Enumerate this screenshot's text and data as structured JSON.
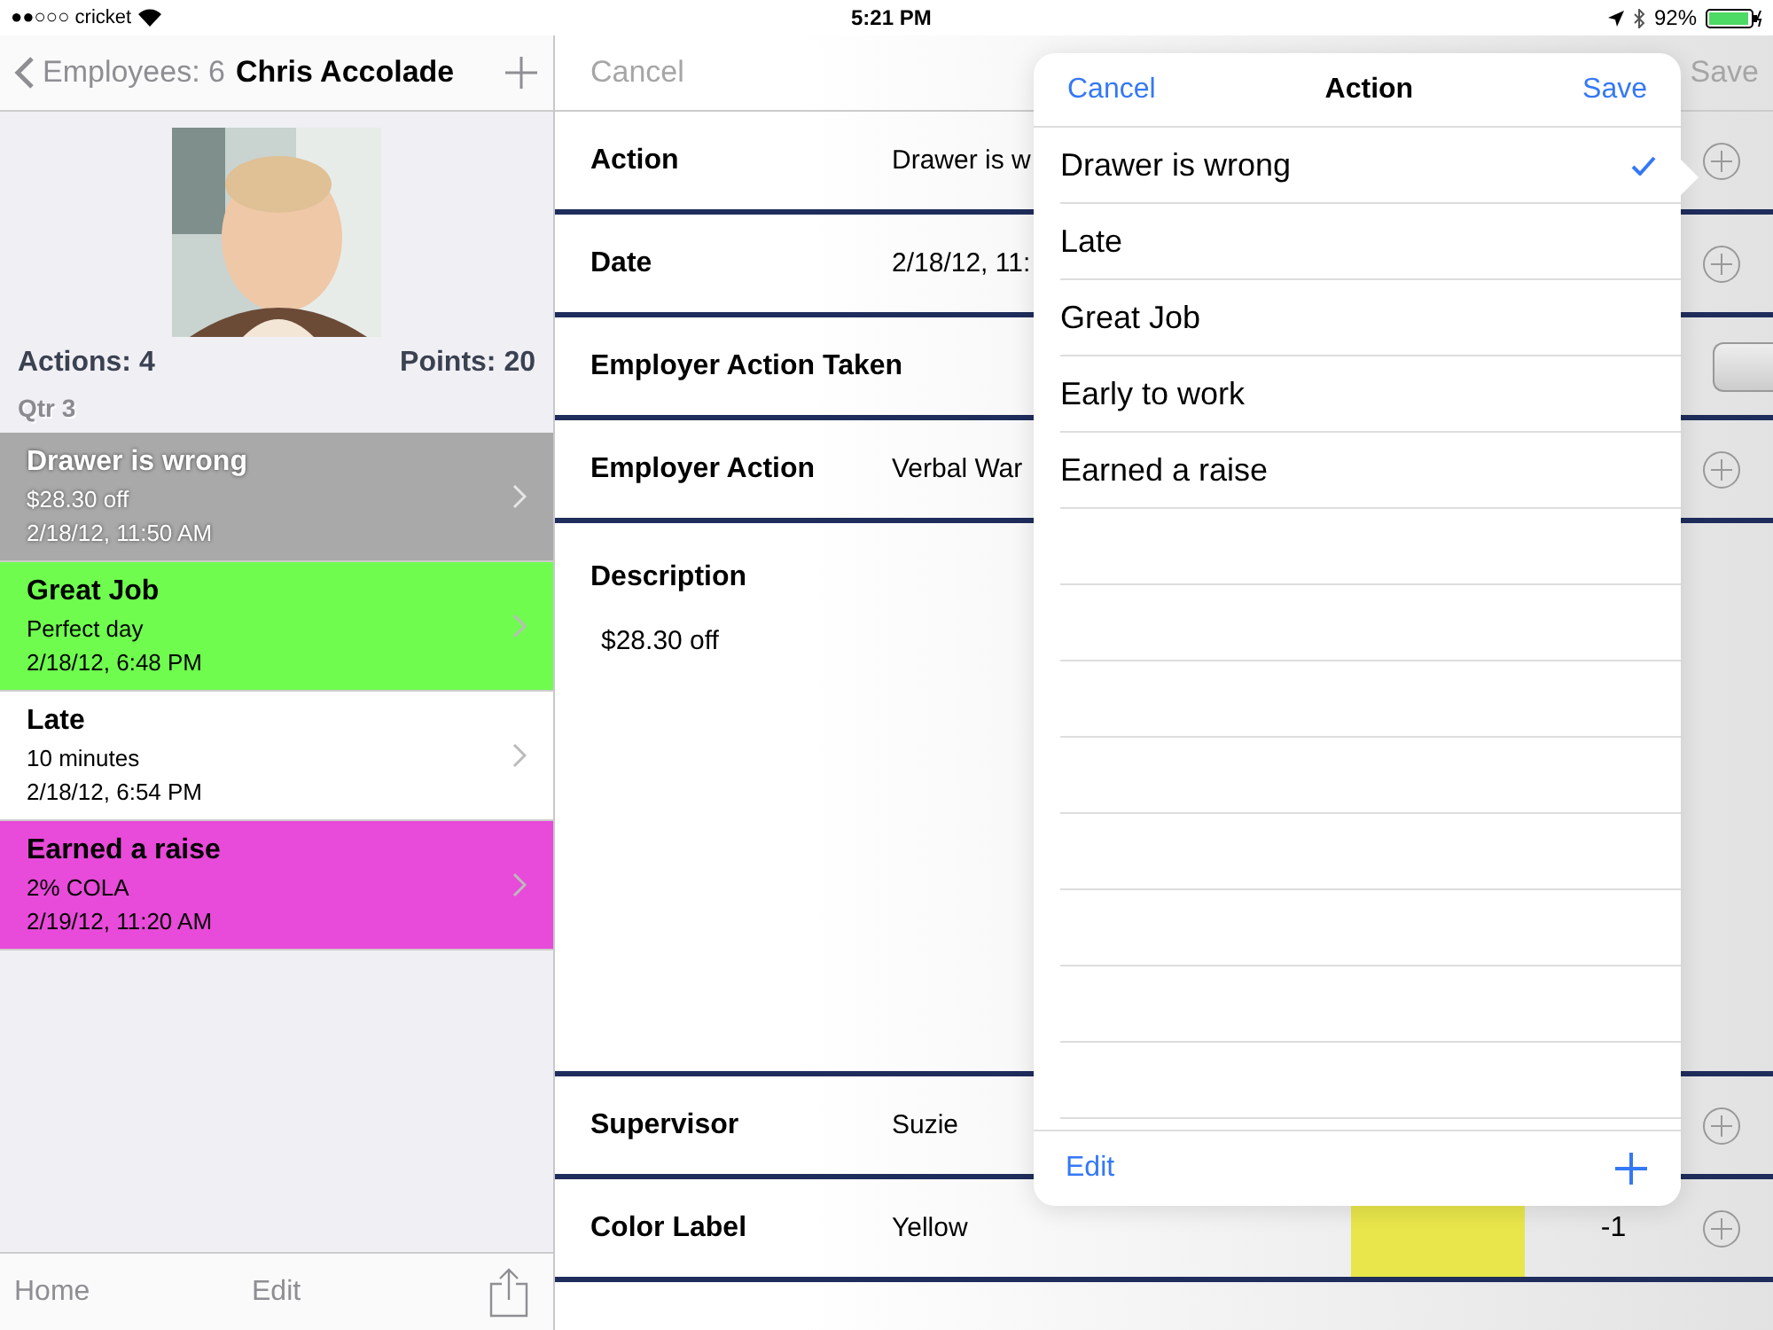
{
  "status_bar": {
    "carrier": "●●○○○ cricket",
    "time": "5:21 PM",
    "battery": "92%"
  },
  "sidebar": {
    "back": "Employees: 6",
    "title": "Chris Accolade",
    "actions": "Actions: 4",
    "points": "Points: 20",
    "section": "Qtr 3",
    "items": [
      {
        "title": "Drawer is wrong",
        "note": "$28.30 off",
        "date": "2/18/12, 11:50 AM",
        "color": "#a9a9a9",
        "selected": true
      },
      {
        "title": "Great Job",
        "note": "Perfect day",
        "date": "2/18/12, 6:48 PM",
        "color": "#6ffc4f",
        "selected": false
      },
      {
        "title": "Late",
        "note": "10 minutes",
        "date": "2/18/12, 6:54 PM",
        "color": "#ffffff",
        "selected": false
      },
      {
        "title": "Earned a raise",
        "note": "2% COLA",
        "date": "2/19/12, 11:20 AM",
        "color": "#e84ad9",
        "selected": false
      }
    ],
    "toolbar": [
      "Home",
      "Edit"
    ]
  },
  "form": {
    "cancel": "Cancel",
    "save": "Save",
    "rows": [
      {
        "kind": "field",
        "label": "Action",
        "value": "Drawer is w"
      },
      {
        "kind": "field",
        "label": "Date",
        "value": "2/18/12, 11:"
      },
      {
        "kind": "toggle",
        "label": "Employer Action Taken",
        "on": false
      },
      {
        "kind": "field",
        "label": "Employer Action",
        "value": "Verbal War"
      },
      {
        "kind": "text",
        "label": "Description",
        "value": "$28.30 off"
      },
      {
        "kind": "field",
        "label": "Supervisor",
        "value": "Suzie"
      },
      {
        "kind": "color",
        "label": "Color Label",
        "value": "Yellow",
        "color": "#e8e64a",
        "points": "-1"
      }
    ]
  },
  "popover": {
    "cancel": "Cancel",
    "title": "Action",
    "save": "Save",
    "edit": "Edit",
    "options": [
      {
        "label": "Drawer is wrong",
        "selected": true
      },
      {
        "label": "Late",
        "selected": false
      },
      {
        "label": "Great Job",
        "selected": false
      },
      {
        "label": "Early to work",
        "selected": false
      },
      {
        "label": "Earned a raise",
        "selected": false
      }
    ]
  }
}
